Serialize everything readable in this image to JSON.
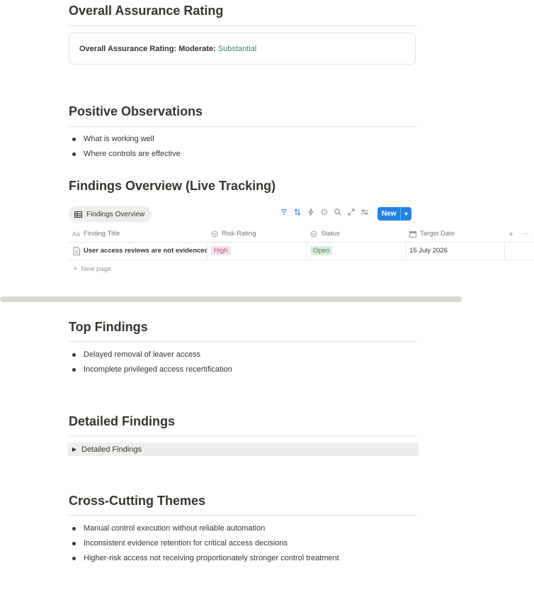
{
  "sections": {
    "assurance": {
      "title": "Overall Assurance Rating",
      "callout_label": "Overall Assurance Rating: Moderate:",
      "callout_value": "Substantial"
    },
    "positive": {
      "title": "Positive Observations",
      "items": [
        "What is working well",
        "Where controls are effective"
      ]
    },
    "findings_overview": {
      "title": "Findings Overview (Live Tracking)",
      "view_tab": "Findings Overview",
      "new_button": "New",
      "columns": [
        "Finding Title",
        "Risk Rating",
        "Status",
        "Target Date"
      ],
      "rows": [
        {
          "title": "User access reviews are not evidenced c",
          "risk": "High",
          "status": "Open",
          "target_date": "15 July 2026"
        }
      ],
      "new_page": "New page"
    },
    "top_findings": {
      "title": "Top Findings",
      "items": [
        "Delayed removal of leaver access",
        "Incomplete privileged access recertification"
      ]
    },
    "detailed": {
      "title": "Detailed Findings",
      "toggle_label": "Detailed Findings"
    },
    "themes": {
      "title": "Cross-Cutting Themes",
      "items": [
        "Manual control execution without reliable automation",
        "Inconsistent evidence retention for critical access decisions",
        "Higher-risk access not receiving proportionately stronger control treatment"
      ]
    }
  },
  "colors": {
    "accent": "#2383e2",
    "green_text": "#448361",
    "high_tag_bg": "#f5e0e9",
    "open_tag_bg": "#dbeddb"
  },
  "icons": {
    "view_tab": "table-icon",
    "toolbar": [
      "filter-icon",
      "sort-icon",
      "lightning-icon",
      "sparkle-icon",
      "search-icon",
      "expand-icon",
      "settings-sliders-icon"
    ],
    "columns": [
      "text-property-icon",
      "select-property-icon",
      "status-property-icon",
      "calendar-icon"
    ],
    "row": "page-icon"
  }
}
